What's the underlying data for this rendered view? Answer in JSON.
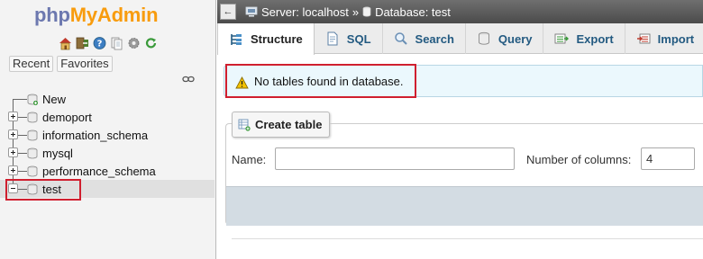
{
  "nav": {
    "logo": {
      "part1": "php",
      "part2": "MyAdmin"
    },
    "quick_icons": [
      "home-icon",
      "exit-icon",
      "help-icon",
      "docs-icon",
      "settings-icon",
      "reload-icon"
    ],
    "tabs": [
      "Recent",
      "Favorites"
    ],
    "tree": [
      {
        "label": "New",
        "expander": "none"
      },
      {
        "label": "demoport",
        "expander": "plus"
      },
      {
        "label": "information_schema",
        "expander": "plus"
      },
      {
        "label": "mysql",
        "expander": "plus"
      },
      {
        "label": "performance_schema",
        "expander": "plus"
      },
      {
        "label": "test",
        "expander": "minus",
        "selected": true
      }
    ]
  },
  "breadcrumb": {
    "server_label": "Server: localhost",
    "separator": "»",
    "database_label": "Database: test"
  },
  "tabs": [
    {
      "label": "Structure",
      "icon": "structure-icon",
      "active": true
    },
    {
      "label": "SQL",
      "icon": "sql-icon"
    },
    {
      "label": "Search",
      "icon": "search-icon"
    },
    {
      "label": "Query",
      "icon": "query-icon"
    },
    {
      "label": "Export",
      "icon": "export-icon"
    },
    {
      "label": "Import",
      "icon": "import-icon"
    }
  ],
  "notice": {
    "text": "No tables found in database.",
    "icon": "warning-icon"
  },
  "create_table": {
    "legend": "Create table",
    "name_label": "Name:",
    "name_value": "",
    "columns_label": "Number of columns:",
    "columns_value": "4"
  },
  "colors": {
    "logo_php": "#6c78af",
    "logo_myadmin": "#f89c0e",
    "tab_link": "#235a81",
    "highlight_box": "#d01f2f",
    "notice_bg": "#ebf8fd",
    "footer_bg": "#d3dce3"
  }
}
